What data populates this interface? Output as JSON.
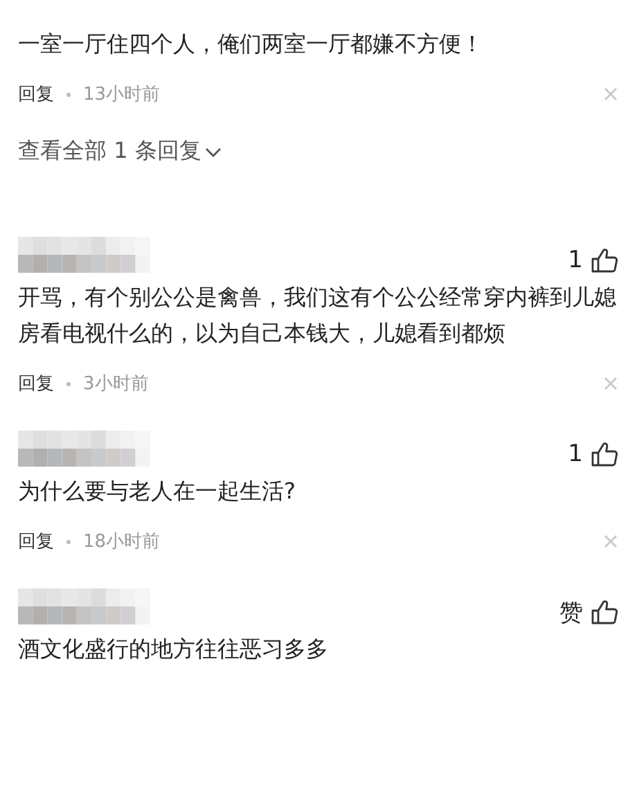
{
  "comments": [
    {
      "text": "一室一厅住四个人，俺们两室一厅都嫌不方便！",
      "reply": "回复",
      "time": "13小时前",
      "view_replies": "查看全部 1 条回复"
    },
    {
      "likes": "1",
      "text": "开骂，有个别公公是禽兽，我们这有个公公经常穿内裤到儿媳房看电视什么的，以为自己本钱大，儿媳看到都烦",
      "reply": "回复",
      "time": "3小时前"
    },
    {
      "likes": "1",
      "text": "为什么要与老人在一起生活?",
      "reply": "回复",
      "time": "18小时前"
    },
    {
      "likes": "赞",
      "text": "酒文化盛行的地方往往恶习多多"
    }
  ]
}
